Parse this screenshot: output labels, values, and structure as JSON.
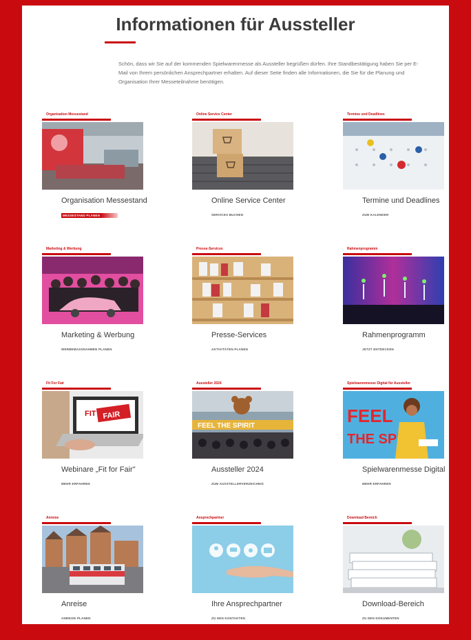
{
  "page": {
    "title": "Informationen für Aussteller",
    "intro": "Schön, dass wir Sie auf der kommenden Spielwarenmesse als Aussteller begrüßen dürfen. Ihre Standbestätigung haben Sie per E-Mail von Ihrem persönlichen Ansprechpartner erhalten. Auf dieser Seite finden alle Informationen, die Sie für die Planung und Organisation Ihrer Messeteilnahme benötigen."
  },
  "cards": [
    {
      "tag": "Organisation Messestand",
      "name": "Organisation Messestand",
      "cta": "MESSESTAND PLANEN",
      "image": "exhibition-stand-photo"
    },
    {
      "tag": "Online Service Center",
      "name": "Online Service Center",
      "cta": "SERVICES BUCHEN",
      "image": "laptop-boxes-photo"
    },
    {
      "tag": "Termine und Deadlines",
      "name": "Termine und Deadlines",
      "cta": "ZUM KALENDER",
      "image": "calendar-pins-photo"
    },
    {
      "tag": "Marketing & Werbung",
      "name": "Marketing & Werbung",
      "cta": "WERBEMASSNAHMEN PLANEN",
      "image": "group-pink-car-photo"
    },
    {
      "tag": "Presse-Services",
      "name": "Presse-Services",
      "cta": "AKTIVITÄTEN PLANEN",
      "image": "press-shelves-photo"
    },
    {
      "tag": "Rahmenprogramm",
      "name": "Rahmenprogramm",
      "cta": "JETZT ENTDECKEN",
      "image": "stage-show-photo"
    },
    {
      "tag": "Fit For Fair",
      "name": "Webinare „Fit for Fair\"",
      "cta": "MEHR ERFAHREN",
      "image": "laptop-fitforfair-photo"
    },
    {
      "tag": "Aussteller 2024",
      "name": "Aussteller 2024",
      "cta": "ZUM AUSSTELLERVERZEICHNIS",
      "image": "feel-the-spirit-bear-photo"
    },
    {
      "tag": "Spielwarenmesse Digital für Aussteller",
      "name": "Spielwarenmesse Digital",
      "cta": "MEHR ERFAHREN",
      "image": "feel-the-spirit-woman-photo"
    },
    {
      "tag": "Anreise",
      "name": "Anreise",
      "cta": "ANREISE PLANEN",
      "image": "nuremberg-tram-photo"
    },
    {
      "tag": "Ansprechpartner",
      "name": "Ihre Ansprechpartner",
      "cta": "ZU DEN KONTAKTEN",
      "image": "contact-icons-hand-photo"
    },
    {
      "tag": "Download Bereich",
      "name": "Download-Bereich",
      "cta": "ZU DEN DOKUMENTEN",
      "image": "document-stack-photo"
    }
  ],
  "image_text": {
    "fit": "FIT",
    "fair": "FAIR",
    "feel": "FEEL",
    "spirit": "THE SPIRIT",
    "banner": "FEEL THE SPIRIT"
  },
  "colors": {
    "brand_red": "#c90a0f",
    "text_dark": "#3c3c3c",
    "background": "#ffffff"
  }
}
